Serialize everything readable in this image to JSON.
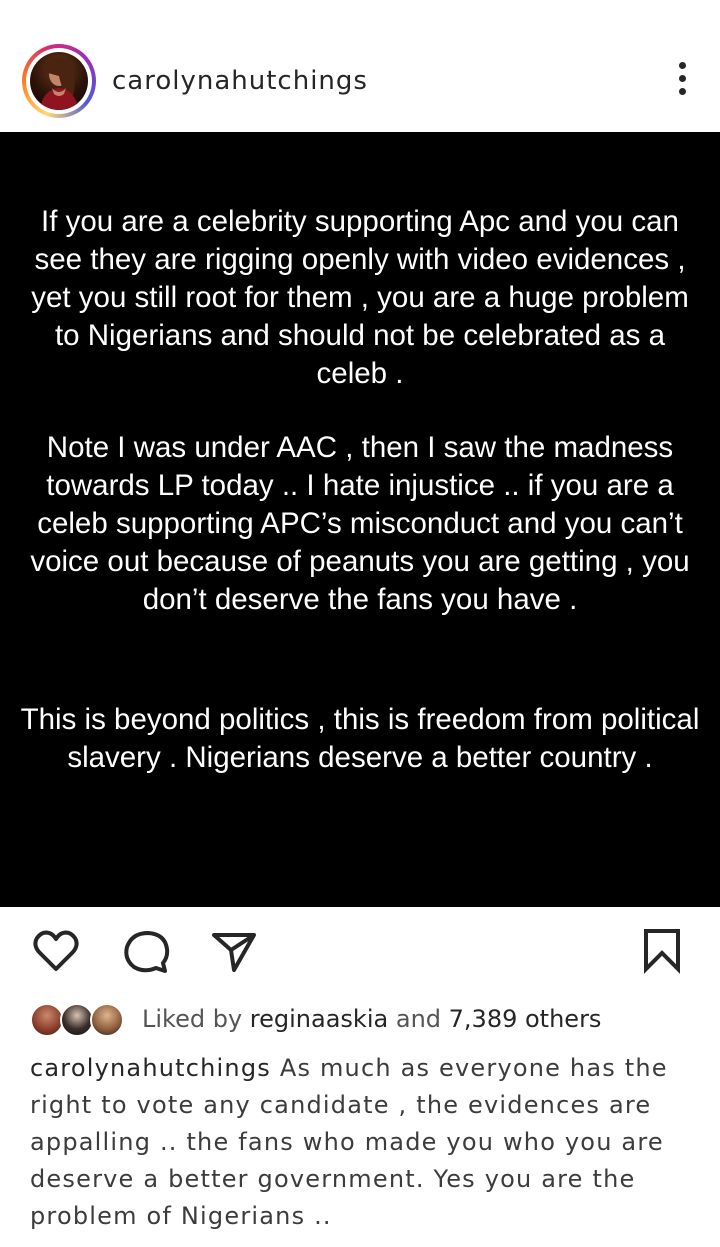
{
  "post": {
    "username": "carolynahutchings",
    "image_text": {
      "paragraph_1": "If you are a celebrity supporting Apc and you can see they are rigging openly with video evidences , yet you still root for them , you are a huge problem to Nigerians and should not be celebrated as a celeb .",
      "paragraph_2": "Note I was under AAC , then I saw the madness towards LP today .. I hate injustice .. if you are a celeb supporting APC’s misconduct and you can’t voice out because of peanuts you are getting , you don’t deserve the fans you have .",
      "paragraph_3": "This is beyond politics , this is freedom from political slavery . Nigerians deserve a better country ."
    },
    "likes": {
      "prefix": "Liked by",
      "liked_by_user": "reginaaskia",
      "connector": "and",
      "others_count": "7,389 others"
    },
    "caption": {
      "username": "carolynahutchings",
      "text": "As much as everyone has the right to vote any candidate , the evidences are appalling .. the fans who made you who you are deserve a better government.  Yes you are the problem of Nigerians .."
    }
  },
  "icons": {
    "more": "more-vertical-icon",
    "like": "heart-icon",
    "comment": "comment-icon",
    "share": "send-icon",
    "save": "bookmark-icon"
  },
  "colors": {
    "text": "#262626",
    "post_background": "#000000",
    "post_text": "#ffffff"
  }
}
